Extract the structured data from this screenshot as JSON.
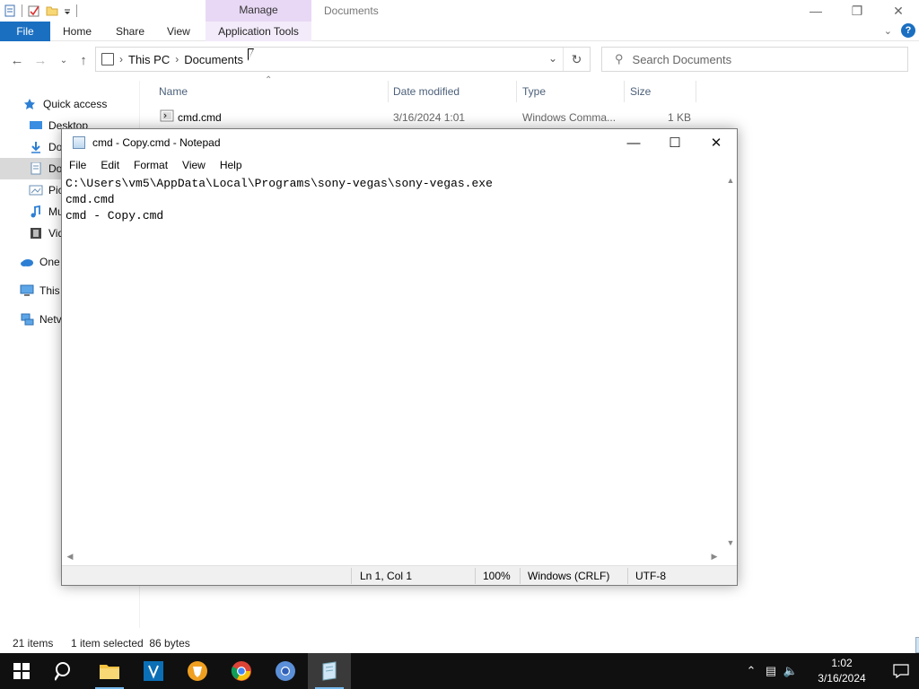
{
  "explorer": {
    "manage_tab": "Manage",
    "window_title": "Documents",
    "ribbon_tabs": [
      "File",
      "Home",
      "Share",
      "View",
      "Application Tools"
    ],
    "breadcrumb": [
      "This PC",
      "Documents"
    ],
    "search_placeholder": "Search Documents",
    "nav": {
      "quick_access": "Quick access",
      "desktop": "Desktop",
      "downloads": "Do",
      "documents": "Do",
      "pictures": "Pic",
      "music": "Mu",
      "videos": "Vid",
      "onedrive": "One",
      "this_pc": "This",
      "network": "Netv"
    },
    "columns": {
      "name": "Name",
      "date": "Date modified",
      "type": "Type",
      "size": "Size"
    },
    "file": {
      "name": "cmd.cmd",
      "date": "3/16/2024 1:01",
      "type": "Windows Comma...",
      "size": "1 KB"
    },
    "status": {
      "items": "21 items",
      "selected": "1 item selected  86 bytes"
    }
  },
  "notepad": {
    "title": "cmd - Copy.cmd - Notepad",
    "menu": [
      "File",
      "Edit",
      "Format",
      "View",
      "Help"
    ],
    "content": "C:\\Users\\vm5\\AppData\\Local\\Programs\\sony-vegas\\sony-vegas.exe\ncmd.cmd\ncmd - Copy.cmd",
    "status": {
      "position": "Ln 1, Col 1",
      "zoom": "100%",
      "line_endings": "Windows (CRLF)",
      "encoding": "UTF-8"
    }
  },
  "taskbar": {
    "time": "1:02",
    "date": "3/16/2024"
  },
  "colors": {
    "ribbon_file": "#1a6fc1",
    "manage_tab": "#e8d8f5",
    "taskbar": "#101010",
    "taskbar_active": "#3a3a3a",
    "selection": "#d9d9d9"
  }
}
